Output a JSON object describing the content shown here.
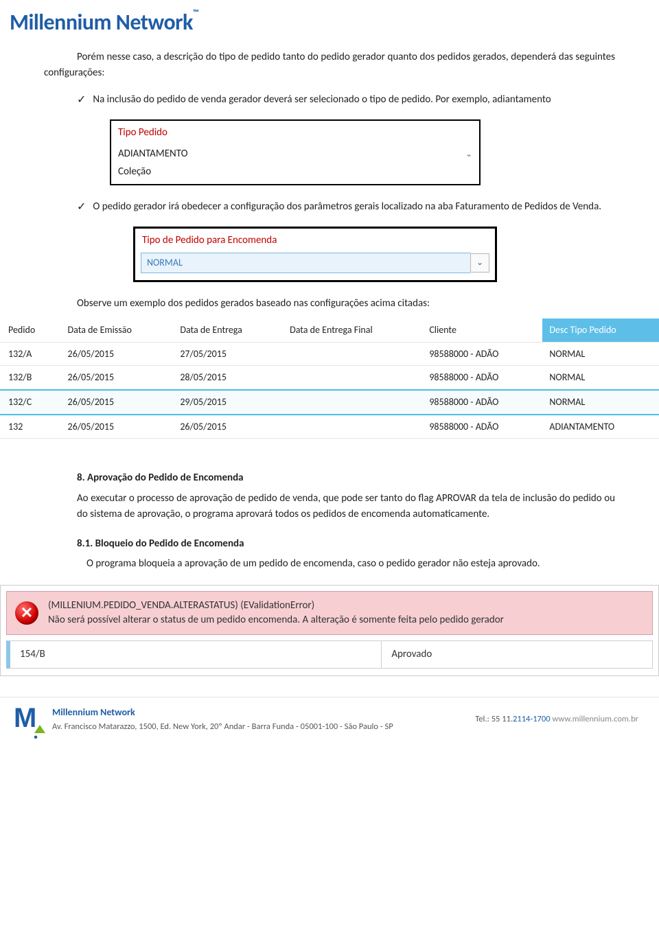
{
  "brand": "Millennium Network",
  "p1": "Porém nesse caso, a descrição do tipo de pedido tanto do pedido gerador quanto dos pedidos gerados, dependerá das seguintes configurações:",
  "b1": "Na inclusão do pedido de venda gerador deverá ser selecionado o tipo de pedido. Por exemplo, adiantamento",
  "box1": {
    "label": "Tipo Pedido",
    "value": "ADIANTAMENTO",
    "sublabel": "Coleção"
  },
  "b2": "O pedido gerador irá obedecer a configuração dos parâmetros gerais localizado na aba Faturamento de Pedidos de Venda.",
  "box2": {
    "label": "Tipo de Pedido para Encomenda",
    "value": "NORMAL"
  },
  "obs": "Observe um exemplo dos pedidos gerados baseado nas configurações acima citadas:",
  "grid": {
    "headers": [
      "Pedido",
      "Data de Emissão",
      "Data de Entrega",
      "Data de Entrega Final",
      "Cliente",
      "Desc Tipo Pedido"
    ],
    "rows": [
      {
        "c": [
          "132/A",
          "26/05/2015",
          "27/05/2015",
          "",
          "98588000 - ADÃO",
          "NORMAL"
        ],
        "sel": false
      },
      {
        "c": [
          "132/B",
          "26/05/2015",
          "28/05/2015",
          "",
          "98588000 - ADÃO",
          "NORMAL"
        ],
        "sel": false
      },
      {
        "c": [
          "132/C",
          "26/05/2015",
          "29/05/2015",
          "",
          "98588000 - ADÃO",
          "NORMAL"
        ],
        "sel": true
      },
      {
        "c": [
          "132",
          "26/05/2015",
          "26/05/2015",
          "",
          "98588000 - ADÃO",
          "ADIANTAMENTO"
        ],
        "sel": false
      }
    ]
  },
  "sec8": {
    "title": "8.   Aprovação do Pedido de Encomenda",
    "body": "Ao executar o processo de aprovação de pedido de venda, que pode ser tanto do flag APROVAR da tela de inclusão do pedido ou do sistema de aprovação, o programa aprovará todos os pedidos de encomenda automaticamente."
  },
  "sec81": {
    "title": "8.1. Bloqueio do Pedido de Encomenda",
    "body": "O programa bloqueia a aprovação de um pedido de encomenda, caso o pedido gerador não esteja aprovado."
  },
  "error": {
    "line1": "(MILLENIUM.PEDIDO_VENDA.ALTERASTATUS) (EValidationError)",
    "line2": "Não será possível alterar o status de um pedido encomenda. A alteração é somente feita pelo pedido gerador",
    "pedido": "154/B",
    "status": "Aprovado"
  },
  "footer": {
    "title": "Millennium Network",
    "addr": "Av. Francisco Matarazzo, 1500, Ed. New York, 20º Andar  - Barra Funda - 05001-100 - São Paulo - SP",
    "tel_label": "Tel.:",
    "tel1": "55 11",
    "tel2": "2114-1700",
    "site": "www.millennium.com.br"
  }
}
